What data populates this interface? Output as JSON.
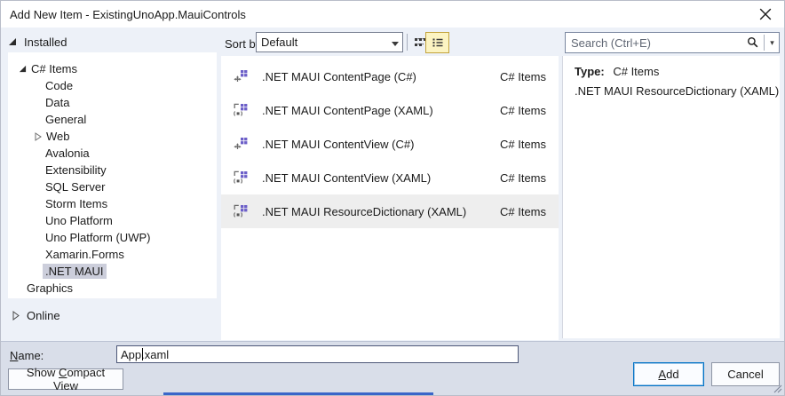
{
  "window": {
    "title": "Add New Item - ExistingUnoApp.MauiControls"
  },
  "left_nav": {
    "installed_label": "Installed",
    "online_label": "Online",
    "items": [
      {
        "label": "C# Items",
        "level": 1,
        "expander": "expanded",
        "selected": false
      },
      {
        "label": "Code",
        "level": 2,
        "expander": "none",
        "selected": false
      },
      {
        "label": "Data",
        "level": 2,
        "expander": "none",
        "selected": false
      },
      {
        "label": "General",
        "level": 2,
        "expander": "none",
        "selected": false
      },
      {
        "label": "Web",
        "level": 2,
        "expander": "collapsed",
        "selected": false
      },
      {
        "label": "Avalonia",
        "level": 2,
        "expander": "none",
        "selected": false
      },
      {
        "label": "Extensibility",
        "level": 2,
        "expander": "none",
        "selected": false
      },
      {
        "label": "SQL Server",
        "level": 2,
        "expander": "none",
        "selected": false
      },
      {
        "label": "Storm Items",
        "level": 2,
        "expander": "none",
        "selected": false
      },
      {
        "label": "Uno Platform",
        "level": 2,
        "expander": "none",
        "selected": false
      },
      {
        "label": "Uno Platform (UWP)",
        "level": 2,
        "expander": "none",
        "selected": false
      },
      {
        "label": "Xamarin.Forms",
        "level": 2,
        "expander": "none",
        "selected": false
      },
      {
        "label": ".NET MAUI",
        "level": 2,
        "expander": "none",
        "selected": true
      },
      {
        "label": "Graphics",
        "level": 1,
        "expander": "none",
        "selected": false
      }
    ]
  },
  "toolbar": {
    "sort_by_label": "Sort by:",
    "sort_value": "Default",
    "view_icons": [
      "small-icons-view-icon",
      "list-view-icon"
    ],
    "active_view": "list-view-icon"
  },
  "search": {
    "placeholder": "Search (Ctrl+E)",
    "icon": "search-icon"
  },
  "template_list": {
    "items": [
      {
        "label": ".NET MAUI ContentPage (C#)",
        "type": "C# Items",
        "icon": "maui-csharp-item-icon",
        "selected": false
      },
      {
        "label": ".NET MAUI ContentPage (XAML)",
        "type": "C# Items",
        "icon": "maui-xaml-item-icon",
        "selected": false
      },
      {
        "label": ".NET MAUI ContentView (C#)",
        "type": "C# Items",
        "icon": "maui-csharp-item-icon",
        "selected": false
      },
      {
        "label": ".NET MAUI ContentView (XAML)",
        "type": "C# Items",
        "icon": "maui-xaml-item-icon",
        "selected": false
      },
      {
        "label": ".NET MAUI ResourceDictionary (XAML)",
        "type": "C# Items",
        "icon": "maui-xaml-item-icon",
        "selected": true
      }
    ]
  },
  "detail_panel": {
    "type_label": "Type:",
    "type_value": "C# Items",
    "description": ".NET MAUI ResourceDictionary (XAML)"
  },
  "footer": {
    "name_label": {
      "key": "N",
      "post": "ame:"
    },
    "name_value": "App.xaml",
    "compact_button": {
      "pre": "Show ",
      "key": "C",
      "post": "ompact View"
    },
    "add_button": {
      "key": "A",
      "post": "dd"
    },
    "cancel_label": "Cancel"
  },
  "colors": {
    "content_bg": "#EDF1F8",
    "footer_bg": "#D9DEE9",
    "tree_selection_inactive": "#CCCEDB",
    "list_selection": "#EEEEEE",
    "accent_blue": "#0072C6",
    "view_toggle_bg": "#FCF4C2",
    "view_toggle_border": "#C2A33C",
    "item_icon_purple": "#6B5EC8",
    "bottom_strip_blue": "#3A66C9"
  }
}
